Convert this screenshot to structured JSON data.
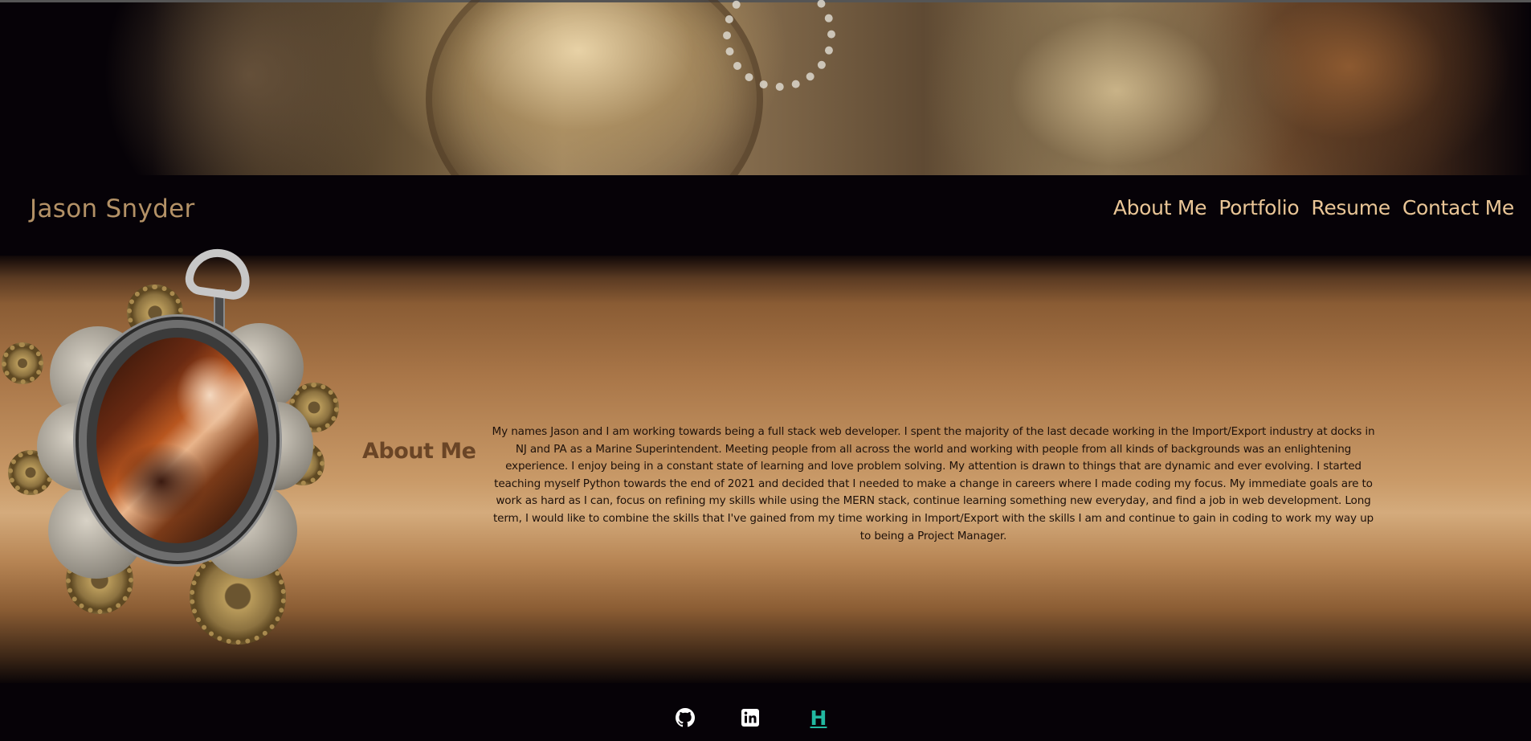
{
  "header": {
    "site_title": "Jason Snyder",
    "nav": [
      "About Me",
      "Portfolio",
      "Resume",
      "Contact Me"
    ]
  },
  "about": {
    "title": "About Me",
    "text": "My names Jason and I am working towards being a full stack web developer. I spent the majority of the last decade working in the Import/Export industry at docks in NJ and PA as a Marine Superintendent. Meeting people from all across the world and working with people from all kinds of backgrounds was an enlightening experience. I enjoy being in a constant state of learning and love problem solving. My attention is drawn to things that are dynamic and ever evolving. I started teaching myself Python towards the end of 2021 and decided that I needed to make a change in careers where I made coding my focus. My immediate goals are to work as hard as I can, focus on refining my skills while using the MERN stack, continue learning something new everyday, and find a job in web development. Long term, I would like to combine the skills that I've gained from my time working in Import/Export with the skills I am and continue to gain in coding to work my way up to being a Project Manager."
  },
  "footer": {
    "icons": [
      "github-icon",
      "linkedin-icon",
      "handshake-h-icon"
    ],
    "h_label": "H"
  },
  "colors": {
    "background": "#060207",
    "title": "#b39166",
    "nav": "#e9c596",
    "about_title": "#6a4526",
    "h_icon": "#22b8a0"
  }
}
